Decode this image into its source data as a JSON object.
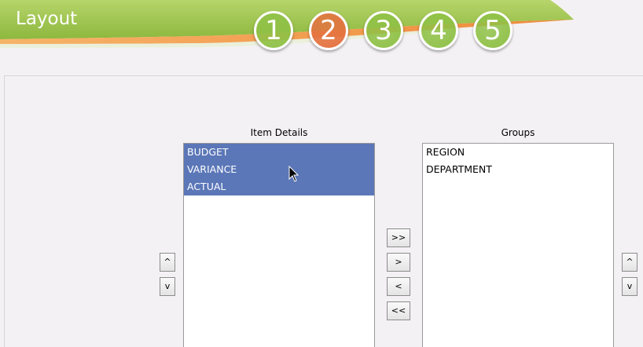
{
  "header": {
    "title": "Layout",
    "steps": [
      {
        "label": "1",
        "state": "inactive"
      },
      {
        "label": "2",
        "state": "current"
      },
      {
        "label": "3",
        "state": "inactive"
      },
      {
        "label": "4",
        "state": "inactive"
      },
      {
        "label": "5",
        "state": "inactive"
      }
    ]
  },
  "colors": {
    "banner_green": "#9cc44d",
    "banner_orange": "#f29a4a",
    "step_inactive": "#8fc146",
    "step_current": "#e5713f",
    "selection": "#5b77b8"
  },
  "item_details": {
    "title": "Item Details",
    "items": [
      {
        "label": "BUDGET",
        "selected": true
      },
      {
        "label": "VARIANCE",
        "selected": true
      },
      {
        "label": "ACTUAL",
        "selected": true
      }
    ]
  },
  "groups": {
    "title": "Groups",
    "items": [
      {
        "label": "REGION",
        "selected": false
      },
      {
        "label": "DEPARTMENT",
        "selected": false
      }
    ]
  },
  "buttons": {
    "move_all_right": ">>",
    "move_right": ">",
    "move_left": "<",
    "move_all_left": "<<",
    "up": "^",
    "down": "v"
  }
}
